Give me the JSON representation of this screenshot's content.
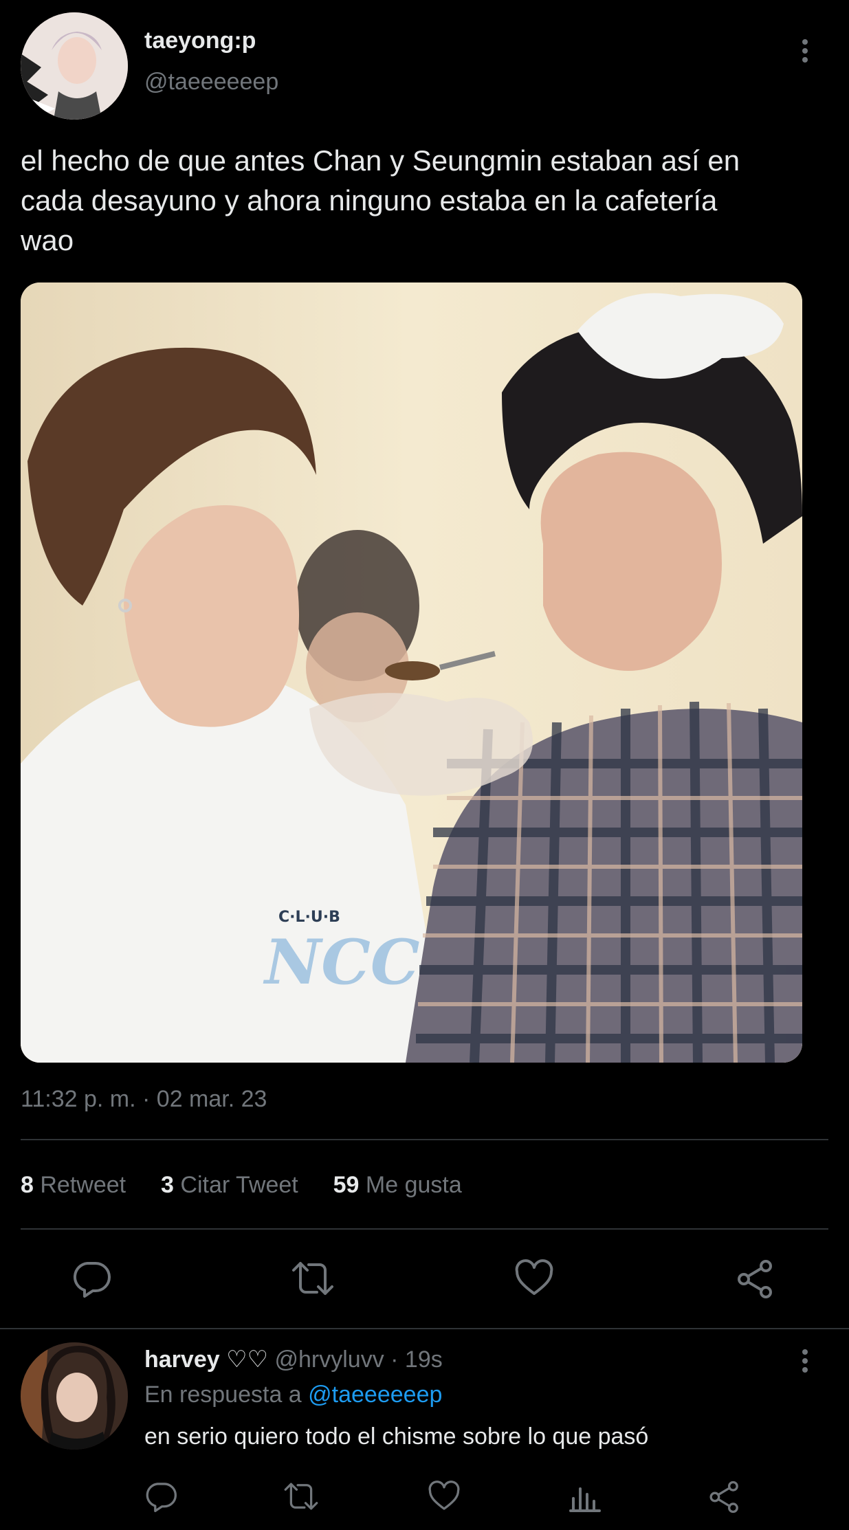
{
  "tweet": {
    "display_name": "taeyong:p",
    "handle": "@taeeeeeep",
    "text_line1": "el hecho de que antes Chan y Seungmin estaban así en",
    "text_line2": "cada desayuno y ahora ninguno estaba en la cafetería",
    "text_line3": "wao",
    "timestamp": "11:32 p. m. · 02 mar. 23",
    "media_text": "C·L·U·B NCC"
  },
  "stats": {
    "retweets_count": "8",
    "retweets_label": "Retweet",
    "quotes_count": "3",
    "quotes_label": "Citar Tweet",
    "likes_count": "59",
    "likes_label": "Me gusta"
  },
  "reply": {
    "display_name": "harvey ♡♡",
    "handle_time": "@hrvyluvv · 19s",
    "in_reply_prefix": "En respuesta a",
    "in_reply_handle": "@taeeeeeep",
    "text": "en serio quiero todo el chisme sobre lo que pasó"
  },
  "icons": [
    "reply-icon",
    "retweet-icon",
    "like-icon",
    "share-icon",
    "analytics-icon",
    "more-icon"
  ],
  "colors": {
    "background": "#000000",
    "text": "#e7e9ea",
    "muted": "#71767b",
    "link": "#1d9bf0",
    "divider": "#2f3336"
  }
}
